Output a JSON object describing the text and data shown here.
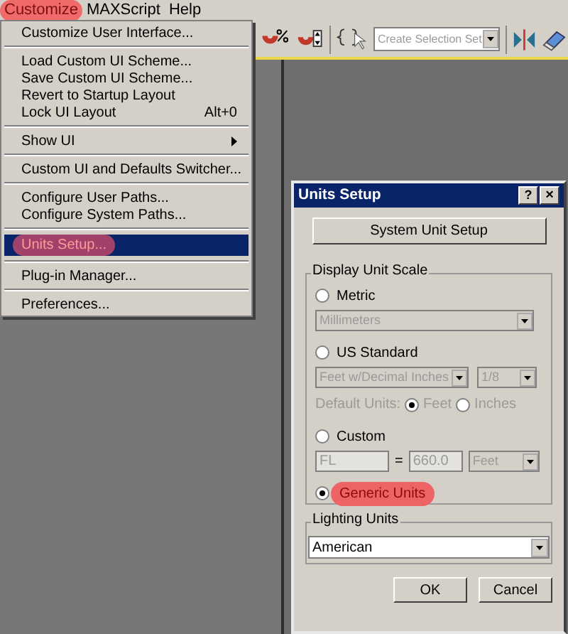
{
  "menu_bar": [
    {
      "label": "Customize",
      "highlighted": true
    },
    {
      "label": "MAXScript",
      "highlighted": false
    },
    {
      "label": "Help",
      "highlighted": false
    }
  ],
  "toolbar": {
    "selection_set": {
      "placeholder": "Create Selection Set"
    }
  },
  "menu": [
    {
      "kind": "item",
      "label": "Customize User Interface...",
      "selected": false,
      "highlighted": false,
      "submenu": false
    },
    {
      "kind": "separator"
    },
    {
      "kind": "item",
      "label": "Load Custom UI Scheme...",
      "selected": false,
      "highlighted": false,
      "submenu": false
    },
    {
      "kind": "item",
      "label": "Save Custom UI Scheme...",
      "selected": false,
      "highlighted": false,
      "submenu": false
    },
    {
      "kind": "item",
      "label": "Revert to Startup Layout",
      "selected": false,
      "highlighted": false,
      "submenu": false
    },
    {
      "kind": "item",
      "label": "Lock UI Layout",
      "shortcut": "Alt+0",
      "selected": false,
      "highlighted": false,
      "submenu": false
    },
    {
      "kind": "separator"
    },
    {
      "kind": "item",
      "label": "Show UI",
      "selected": false,
      "highlighted": false,
      "submenu": true
    },
    {
      "kind": "separator"
    },
    {
      "kind": "item",
      "label": "Custom UI and Defaults Switcher...",
      "selected": false,
      "highlighted": false,
      "submenu": false
    },
    {
      "kind": "separator"
    },
    {
      "kind": "item",
      "label": "Configure User Paths...",
      "selected": false,
      "highlighted": false,
      "submenu": false
    },
    {
      "kind": "item",
      "label": "Configure System Paths...",
      "selected": false,
      "highlighted": false,
      "submenu": false
    },
    {
      "kind": "separator"
    },
    {
      "kind": "item",
      "label": "Units Setup...",
      "selected": true,
      "highlighted": true,
      "submenu": false
    },
    {
      "kind": "separator"
    },
    {
      "kind": "item",
      "label": "Plug-in Manager...",
      "selected": false,
      "highlighted": false,
      "submenu": false
    },
    {
      "kind": "separator"
    },
    {
      "kind": "item",
      "label": "Preferences...",
      "selected": false,
      "highlighted": false,
      "submenu": false
    }
  ],
  "dialog": {
    "title": "Units Setup",
    "help_button": "?",
    "close_button": "×",
    "system_button": "System Unit Setup",
    "display_unit_scale": {
      "title": "Display Unit Scale",
      "options": [
        {
          "kind": "metric",
          "label": "Metric",
          "selected": false,
          "highlighted": false,
          "dropdowns": [
            {
              "value": "Millimeters",
              "disabled": true
            }
          ]
        },
        {
          "kind": "us",
          "label": "US Standard",
          "selected": false,
          "highlighted": false,
          "dropdowns": [
            {
              "value": "Feet w/Decimal Inches",
              "disabled": true
            },
            {
              "value": "1/8",
              "disabled": true
            }
          ],
          "default_units": {
            "label": "Default Units:",
            "disabled": true,
            "choices": [
              {
                "label": "Feet",
                "selected": true
              },
              {
                "label": "Inches",
                "selected": false
              }
            ]
          }
        },
        {
          "kind": "custom",
          "label": "Custom",
          "selected": false,
          "highlighted": false,
          "custom": {
            "name": "FL",
            "equals": "=",
            "value": "660.0",
            "unit": "Feet",
            "disabled": true
          }
        },
        {
          "kind": "generic",
          "label": "Generic Units",
          "selected": true,
          "highlighted": true
        }
      ]
    },
    "lighting_units": {
      "title": "Lighting Units",
      "value": "American"
    },
    "buttons": [
      "OK",
      "Cancel"
    ]
  }
}
